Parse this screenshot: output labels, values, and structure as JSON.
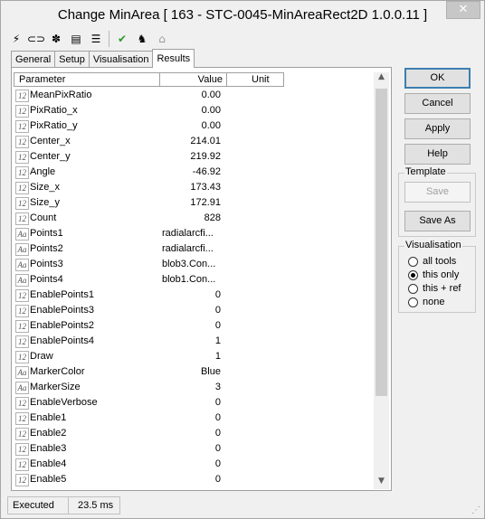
{
  "window": {
    "title": "Change MinArea [ 163 - STC-0045-MinAreaRect2D 1.0.0.11 ]",
    "close_glyph": "✕"
  },
  "toolbar": [
    {
      "name": "lightning-icon",
      "glyph": "⚡"
    },
    {
      "name": "link-icon",
      "glyph": "⊂⊃"
    },
    {
      "name": "puzzle-icon",
      "glyph": "✽"
    },
    {
      "name": "console-icon",
      "glyph": "▤"
    },
    {
      "name": "list-icon",
      "glyph": "☰"
    },
    {
      "name": "check-icon",
      "glyph": "✔"
    },
    {
      "name": "person-icon",
      "glyph": "♞"
    },
    {
      "name": "network-icon",
      "glyph": "⌂"
    }
  ],
  "tabs": [
    "General",
    "Setup",
    "Visualisation",
    "Results"
  ],
  "grid": {
    "headers": [
      "Parameter",
      "Value",
      "Unit"
    ],
    "rows": [
      {
        "type": "12",
        "name": "MeanPixRatio",
        "value": "0.00"
      },
      {
        "type": "12",
        "name": "PixRatio_x",
        "value": "0.00"
      },
      {
        "type": "12",
        "name": "PixRatio_y",
        "value": "0.00"
      },
      {
        "type": "12",
        "name": "Center_x",
        "value": "214.01"
      },
      {
        "type": "12",
        "name": "Center_y",
        "value": "219.92"
      },
      {
        "type": "12",
        "name": "Angle",
        "value": "-46.92"
      },
      {
        "type": "12",
        "name": "Size_x",
        "value": "173.43"
      },
      {
        "type": "12",
        "name": "Size_y",
        "value": "172.91"
      },
      {
        "type": "12",
        "name": "Count",
        "value": "828"
      },
      {
        "type": "Aa",
        "name": "Points1",
        "value": "radialarcfi...",
        "text": true
      },
      {
        "type": "Aa",
        "name": "Points2",
        "value": "radialarcfi...",
        "text": true
      },
      {
        "type": "Aa",
        "name": "Points3",
        "value": "blob3.Con...",
        "text": true
      },
      {
        "type": "Aa",
        "name": "Points4",
        "value": "blob1.Con...",
        "text": true
      },
      {
        "type": "12",
        "name": "EnablePoints1",
        "value": "0"
      },
      {
        "type": "12",
        "name": "EnablePoints3",
        "value": "0"
      },
      {
        "type": "12",
        "name": "EnablePoints2",
        "value": "0"
      },
      {
        "type": "12",
        "name": "EnablePoints4",
        "value": "1"
      },
      {
        "type": "12",
        "name": "Draw",
        "value": "1"
      },
      {
        "type": "Aa",
        "name": "MarkerColor",
        "value": "Blue"
      },
      {
        "type": "Aa",
        "name": "MarkerSize",
        "value": "3"
      },
      {
        "type": "12",
        "name": "EnableVerbose",
        "value": "0"
      },
      {
        "type": "12",
        "name": "Enable1",
        "value": "0"
      },
      {
        "type": "12",
        "name": "Enable2",
        "value": "0"
      },
      {
        "type": "12",
        "name": "Enable3",
        "value": "0"
      },
      {
        "type": "12",
        "name": "Enable4",
        "value": "0"
      },
      {
        "type": "12",
        "name": "Enable5",
        "value": "0"
      }
    ]
  },
  "buttons": {
    "ok": "OK",
    "cancel": "Cancel",
    "apply": "Apply",
    "help": "Help"
  },
  "template": {
    "title": "Template",
    "save": "Save",
    "save_as": "Save As"
  },
  "visualisation": {
    "title": "Visualisation",
    "options": [
      "all tools",
      "this only",
      "this + ref",
      "none"
    ],
    "selected": "this only"
  },
  "status": {
    "state": "Executed",
    "time": "23.5 ms"
  }
}
